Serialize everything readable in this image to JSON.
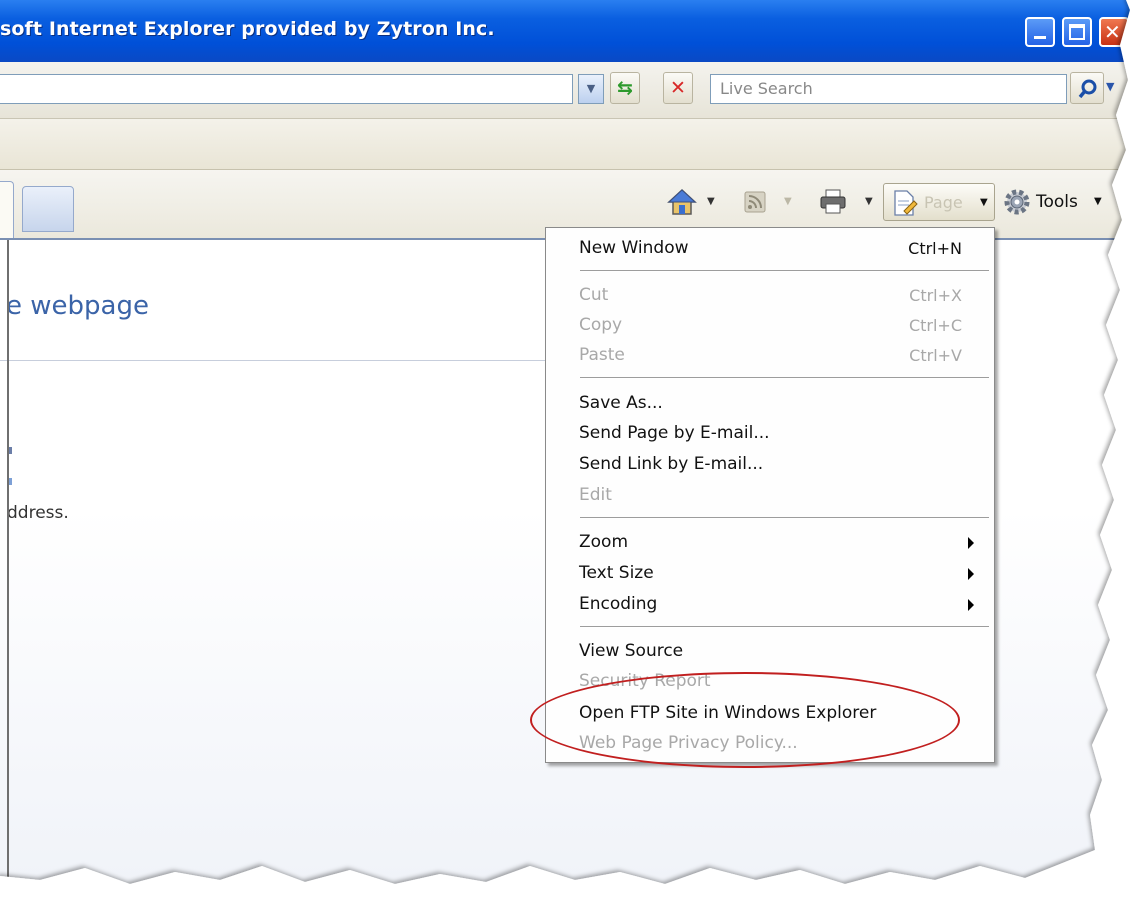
{
  "window": {
    "title": "soft Internet Explorer provided by Zytron Inc."
  },
  "address_bar": {
    "search_placeholder": "Live Search"
  },
  "command_bar": {
    "page_label": "Page",
    "tools_label": "Tools"
  },
  "content": {
    "heading": "e webpage",
    "body_text": "ddress."
  },
  "menu": {
    "items": [
      {
        "label": "New Window",
        "shortcut": "Ctrl+N",
        "enabled": true
      },
      {
        "label": "Cut",
        "shortcut": "Ctrl+X",
        "enabled": false
      },
      {
        "label": "Copy",
        "shortcut": "Ctrl+C",
        "enabled": false
      },
      {
        "label": "Paste",
        "shortcut": "Ctrl+V",
        "enabled": false
      },
      {
        "label": "Save As...",
        "enabled": true
      },
      {
        "label": "Send Page by E-mail...",
        "enabled": true
      },
      {
        "label": "Send Link by E-mail...",
        "enabled": true
      },
      {
        "label": "Edit",
        "enabled": false
      },
      {
        "label": "Zoom",
        "enabled": true,
        "submenu": true
      },
      {
        "label": "Text Size",
        "enabled": true,
        "submenu": true
      },
      {
        "label": "Encoding",
        "enabled": true,
        "submenu": true
      },
      {
        "label": "View Source",
        "enabled": true
      },
      {
        "label": "Security Report",
        "enabled": false
      },
      {
        "label": "Open FTP Site in Windows Explorer",
        "enabled": true
      },
      {
        "label": "Web Page Privacy Policy...",
        "enabled": false
      }
    ]
  },
  "colors": {
    "titlebar": "#0054e3",
    "heading": "#3b64a8",
    "highlight_oval": "#c11f1f",
    "disabled_text": "#a8a8a8"
  },
  "icons": [
    "minimize-icon",
    "maximize-icon",
    "close-icon",
    "dropdown-arrow-icon",
    "refresh-icon",
    "stop-icon",
    "search-icon",
    "home-icon",
    "feeds-icon",
    "print-icon",
    "page-icon",
    "tools-gear-icon",
    "submenu-arrow-icon"
  ]
}
